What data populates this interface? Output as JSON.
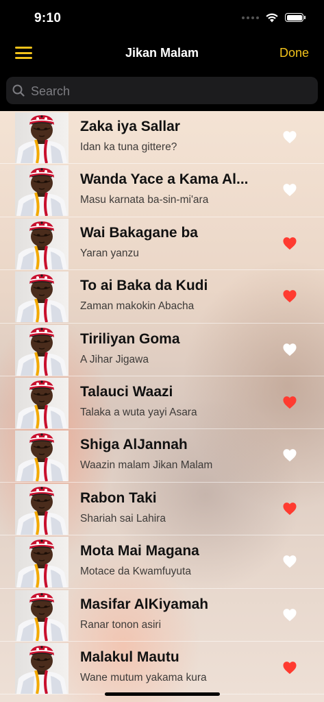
{
  "status_bar": {
    "time": "9:10"
  },
  "nav": {
    "title": "Jikan Malam",
    "done_label": "Done",
    "menu_icon": "hamburger-menu-icon",
    "accent_color": "#f2c21b"
  },
  "search": {
    "placeholder": "Search",
    "value": ""
  },
  "heart_colors": {
    "favorite": "#ff3b30",
    "not_favorite": "#ffffff"
  },
  "items": [
    {
      "title": "Zaka iya Sallar",
      "subtitle": "Idan ka tuna gittere?",
      "favorite": false
    },
    {
      "title": "Wanda Yace a Kama Al...",
      "subtitle": "Masu karnata ba-sin-mi'ara",
      "favorite": false
    },
    {
      "title": "Wai Bakagane ba",
      "subtitle": "Yaran yanzu",
      "favorite": true
    },
    {
      "title": "To ai Baka da Kudi",
      "subtitle": "Zaman makokin Abacha",
      "favorite": true
    },
    {
      "title": "Tiriliyan Goma",
      "subtitle": "A Jihar Jigawa",
      "favorite": false
    },
    {
      "title": "Talauci Waazi",
      "subtitle": "Talaka a wuta yayi Asara",
      "favorite": true
    },
    {
      "title": "Shiga AlJannah",
      "subtitle": "Waazin malam Jikan Malam",
      "favorite": false
    },
    {
      "title": "Rabon Taki",
      "subtitle": "Shariah sai Lahira",
      "favorite": true
    },
    {
      "title": "Mota Mai Magana",
      "subtitle": "Motace da Kwamfuyuta",
      "favorite": false
    },
    {
      "title": "Masifar AlKiyamah",
      "subtitle": "Ranar tonon asiri",
      "favorite": false
    },
    {
      "title": "Malakul Mautu",
      "subtitle": "Wane mutum yakama kura",
      "favorite": true
    }
  ]
}
